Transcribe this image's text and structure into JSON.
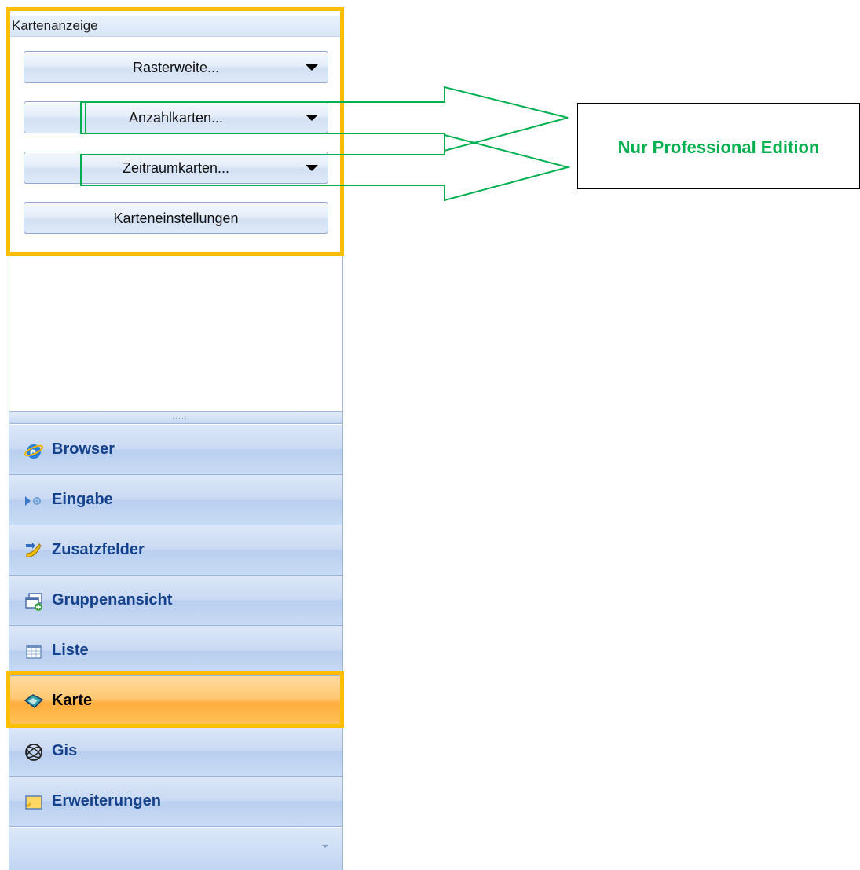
{
  "panel": {
    "group_title": "Kartenanzeige",
    "buttons": [
      {
        "label": "Rasterweite...",
        "has_dropdown": true
      },
      {
        "label": "Anzahlkarten...",
        "has_dropdown": true
      },
      {
        "label": "Zeitraumkarten...",
        "has_dropdown": true
      },
      {
        "label": "Karteneinstellungen",
        "has_dropdown": false
      }
    ]
  },
  "nav": {
    "items": [
      {
        "label": "Browser",
        "icon": "browser-globe-icon",
        "active": false
      },
      {
        "label": "Eingabe",
        "icon": "input-arrow-icon",
        "active": false
      },
      {
        "label": "Zusatzfelder",
        "icon": "extra-fields-icon",
        "active": false
      },
      {
        "label": "Gruppenansicht",
        "icon": "group-view-icon",
        "active": false
      },
      {
        "label": "Liste",
        "icon": "list-icon",
        "active": false
      },
      {
        "label": "Karte",
        "icon": "map-icon",
        "active": true
      },
      {
        "label": "Gis",
        "icon": "gis-globe-icon",
        "active": false
      },
      {
        "label": "Erweiterungen",
        "icon": "extensions-icon",
        "active": false
      }
    ]
  },
  "annotation": {
    "text": "Nur Professional Edition",
    "text_color": "#00b050",
    "highlight_color": "#ffbf00"
  }
}
